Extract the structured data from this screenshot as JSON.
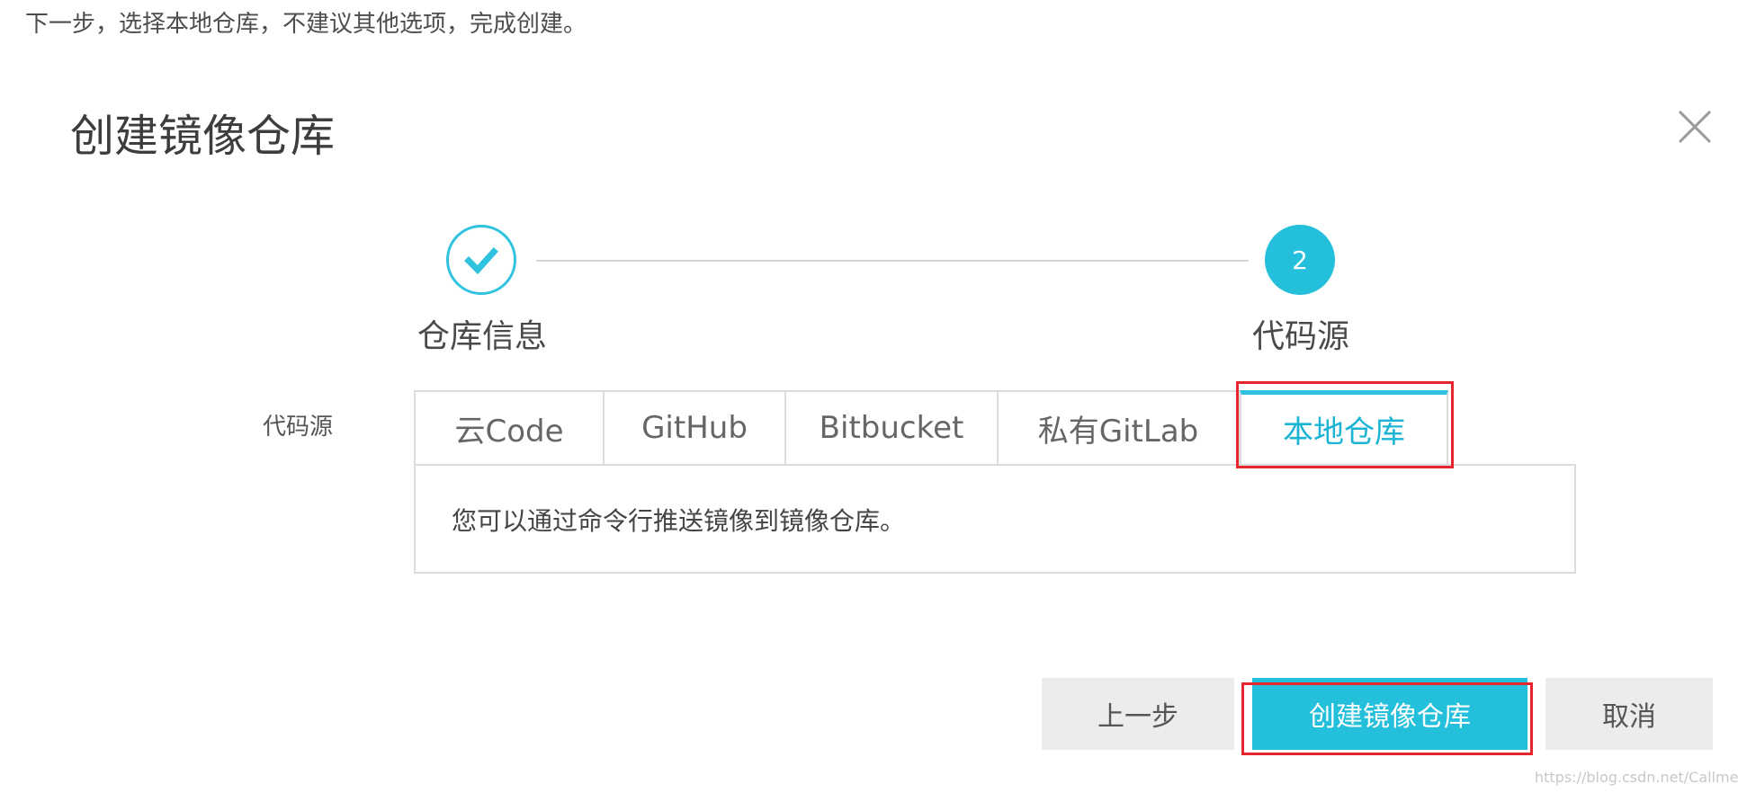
{
  "intro_text": "下一步，选择本地仓库，不建议其他选项，完成创建。",
  "dialog": {
    "title": "创建镜像仓库",
    "close_icon": "close-icon"
  },
  "steps": [
    {
      "label": "仓库信息",
      "state": "done",
      "icon": "check-icon"
    },
    {
      "label": "代码源",
      "state": "active",
      "number": "2"
    }
  ],
  "form": {
    "field_label": "代码源",
    "tabs": [
      {
        "label": "云Code",
        "active": false
      },
      {
        "label": "GitHub",
        "active": false
      },
      {
        "label": "Bitbucket",
        "active": false
      },
      {
        "label": "私有GitLab",
        "active": false
      },
      {
        "label": "本地仓库",
        "active": true
      }
    ],
    "panel_text": "您可以通过命令行推送镜像到镜像仓库。"
  },
  "buttons": {
    "prev": "上一步",
    "create": "创建镜像仓库",
    "cancel": "取消"
  },
  "colors": {
    "accent": "#24bfdb",
    "highlight": "#e5262f",
    "button_gray": "#ececec"
  },
  "watermark": "https://blog.csdn.net/Callmebig"
}
